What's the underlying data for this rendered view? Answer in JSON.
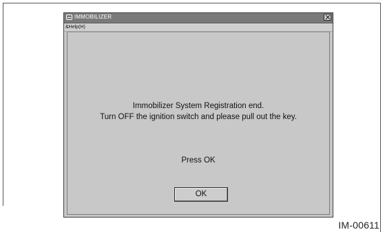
{
  "window": {
    "title": "IMMOBILIZER",
    "close_icon": "close-icon",
    "app_icon": "immobilizer-app-icon"
  },
  "menu": {
    "help_label": "&Help(H)"
  },
  "dialog": {
    "message_line1": "Immobilizer System Registration end.",
    "message_line2": "Turn OFF the ignition switch and please pull out the key.",
    "prompt": "Press OK",
    "ok_label": "OK"
  },
  "figure_id": "IM-00611"
}
